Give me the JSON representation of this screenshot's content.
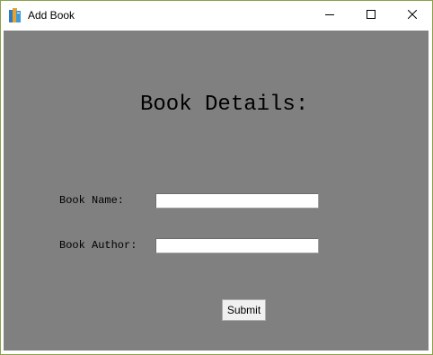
{
  "window": {
    "title": "Add Book",
    "icon": "books-app-icon",
    "controls": {
      "minimize_icon": "minimize-icon",
      "maximize_icon": "maximize-icon",
      "close_icon": "close-icon"
    }
  },
  "form": {
    "heading": "Book Details:",
    "fields": [
      {
        "label": "Book Name:",
        "value": "",
        "placeholder": ""
      },
      {
        "label": "Book Author:",
        "value": "",
        "placeholder": ""
      }
    ],
    "submit_label": "Submit"
  },
  "colors": {
    "window_background": "#808080",
    "titlebar_background": "#ffffff",
    "window_border": "#8aa24a",
    "button_face": "#f0f0f0"
  }
}
